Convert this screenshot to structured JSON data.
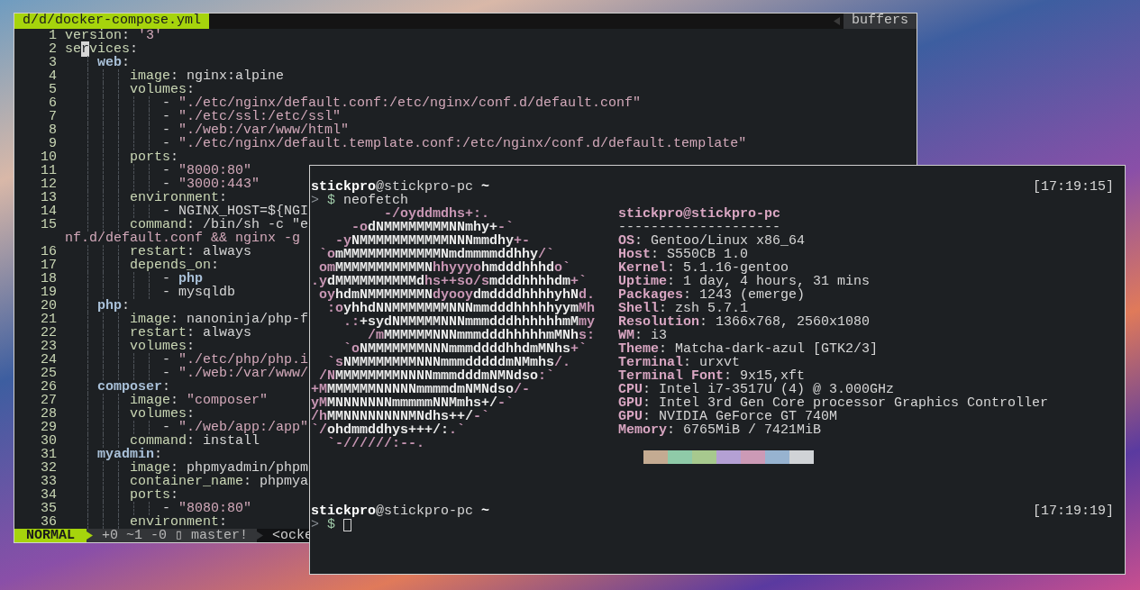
{
  "editor": {
    "tab": "d/d/docker-compose.yml",
    "buffers_label": "buffers",
    "lines": [
      {
        "number": "1",
        "segments": [
          {
            "kind": "key",
            "text": "version"
          },
          {
            "kind": "plain",
            "text": ": "
          },
          {
            "kind": "string",
            "text": "'3'"
          }
        ]
      },
      {
        "number": "2",
        "segments": [
          {
            "kind": "key",
            "text": "se"
          },
          {
            "kind": "cursor",
            "text": "r"
          },
          {
            "kind": "key",
            "text": "vices"
          },
          {
            "kind": "plain",
            "text": ":"
          }
        ]
      },
      {
        "number": "3",
        "segments": [
          {
            "kind": "section",
            "text": "    web"
          },
          {
            "kind": "plain",
            "text": ":"
          }
        ]
      },
      {
        "number": "4",
        "segments": [
          {
            "kind": "key",
            "text": "        image"
          },
          {
            "kind": "plain",
            "text": ": nginx:alpine"
          }
        ]
      },
      {
        "number": "5",
        "segments": [
          {
            "kind": "key",
            "text": "        volumes"
          },
          {
            "kind": "plain",
            "text": ":"
          }
        ]
      },
      {
        "number": "6",
        "segments": [
          {
            "kind": "plain",
            "text": "            - "
          },
          {
            "kind": "string",
            "text": "\"./etc/nginx/default.conf:/etc/nginx/conf.d/default.conf\""
          }
        ]
      },
      {
        "number": "7",
        "segments": [
          {
            "kind": "plain",
            "text": "            - "
          },
          {
            "kind": "string",
            "text": "\"./etc/ssl:/etc/ssl\""
          }
        ]
      },
      {
        "number": "8",
        "segments": [
          {
            "kind": "plain",
            "text": "            - "
          },
          {
            "kind": "string",
            "text": "\"./web:/var/www/html\""
          }
        ]
      },
      {
        "number": "9",
        "segments": [
          {
            "kind": "plain",
            "text": "            - "
          },
          {
            "kind": "string",
            "text": "\"./etc/nginx/default.template.conf:/etc/nginx/conf.d/default.template\""
          }
        ]
      },
      {
        "number": "10",
        "segments": [
          {
            "kind": "key",
            "text": "        ports"
          },
          {
            "kind": "plain",
            "text": ":"
          }
        ]
      },
      {
        "number": "11",
        "segments": [
          {
            "kind": "plain",
            "text": "            - "
          },
          {
            "kind": "string",
            "text": "\"8000:80\""
          }
        ]
      },
      {
        "number": "12",
        "segments": [
          {
            "kind": "plain",
            "text": "            - "
          },
          {
            "kind": "string",
            "text": "\"3000:443\""
          }
        ]
      },
      {
        "number": "13",
        "segments": [
          {
            "kind": "key",
            "text": "        environment"
          },
          {
            "kind": "plain",
            "text": ":"
          }
        ]
      },
      {
        "number": "14",
        "segments": [
          {
            "kind": "plain",
            "text": "            - NGINX_HOST=${NGI"
          }
        ]
      },
      {
        "number": "15",
        "segments": [
          {
            "kind": "key",
            "text": "        command"
          },
          {
            "kind": "plain",
            "text": ": /bin/sh -c \"e"
          }
        ],
        "wrap": "nf.d/default.conf && nginx -g"
      },
      {
        "number": "16",
        "segments": [
          {
            "kind": "key",
            "text": "        restart"
          },
          {
            "kind": "plain",
            "text": ": always"
          }
        ]
      },
      {
        "number": "17",
        "segments": [
          {
            "kind": "key",
            "text": "        depends_on"
          },
          {
            "kind": "plain",
            "text": ":"
          }
        ]
      },
      {
        "number": "18",
        "segments": [
          {
            "kind": "plain",
            "text": "            - "
          },
          {
            "kind": "section",
            "text": "php"
          }
        ]
      },
      {
        "number": "19",
        "segments": [
          {
            "kind": "plain",
            "text": "            - mysqldb"
          }
        ]
      },
      {
        "number": "20",
        "segments": [
          {
            "kind": "section",
            "text": "    php"
          },
          {
            "kind": "plain",
            "text": ":"
          }
        ]
      },
      {
        "number": "21",
        "segments": [
          {
            "kind": "key",
            "text": "        image"
          },
          {
            "kind": "plain",
            "text": ": nanoninja/php-f"
          }
        ]
      },
      {
        "number": "22",
        "segments": [
          {
            "kind": "key",
            "text": "        restart"
          },
          {
            "kind": "plain",
            "text": ": always"
          }
        ]
      },
      {
        "number": "23",
        "segments": [
          {
            "kind": "key",
            "text": "        volumes"
          },
          {
            "kind": "plain",
            "text": ":"
          }
        ]
      },
      {
        "number": "24",
        "segments": [
          {
            "kind": "plain",
            "text": "            - "
          },
          {
            "kind": "string",
            "text": "\"./etc/php/php.i"
          }
        ]
      },
      {
        "number": "25",
        "segments": [
          {
            "kind": "plain",
            "text": "            - "
          },
          {
            "kind": "string",
            "text": "\"./web:/var/www/"
          }
        ]
      },
      {
        "number": "26",
        "segments": [
          {
            "kind": "section",
            "text": "    composer"
          },
          {
            "kind": "plain",
            "text": ":"
          }
        ]
      },
      {
        "number": "27",
        "segments": [
          {
            "kind": "key",
            "text": "        image"
          },
          {
            "kind": "plain",
            "text": ": "
          },
          {
            "kind": "string",
            "text": "\"composer\""
          }
        ]
      },
      {
        "number": "28",
        "segments": [
          {
            "kind": "key",
            "text": "        volumes"
          },
          {
            "kind": "plain",
            "text": ":"
          }
        ]
      },
      {
        "number": "29",
        "segments": [
          {
            "kind": "plain",
            "text": "            - "
          },
          {
            "kind": "string",
            "text": "\"./web/app:/app\""
          }
        ]
      },
      {
        "number": "30",
        "segments": [
          {
            "kind": "key",
            "text": "        command"
          },
          {
            "kind": "plain",
            "text": ": install"
          }
        ]
      },
      {
        "number": "31",
        "segments": [
          {
            "kind": "section",
            "text": "    myadmin"
          },
          {
            "kind": "plain",
            "text": ":"
          }
        ]
      },
      {
        "number": "32",
        "segments": [
          {
            "kind": "key",
            "text": "        image"
          },
          {
            "kind": "plain",
            "text": ": phpmyadmin/phpm"
          }
        ]
      },
      {
        "number": "33",
        "segments": [
          {
            "kind": "key",
            "text": "        container_name"
          },
          {
            "kind": "plain",
            "text": ": phpmya"
          }
        ]
      },
      {
        "number": "34",
        "segments": [
          {
            "kind": "key",
            "text": "        ports"
          },
          {
            "kind": "plain",
            "text": ":"
          }
        ]
      },
      {
        "number": "35",
        "segments": [
          {
            "kind": "plain",
            "text": "            - "
          },
          {
            "kind": "string",
            "text": "\"8080:80\""
          }
        ]
      },
      {
        "number": "36",
        "segments": [
          {
            "kind": "key",
            "text": "        environment"
          },
          {
            "kind": "plain",
            "text": ":"
          }
        ]
      }
    ],
    "status": {
      "mode": "NORMAL",
      "git": "+0 ~1 -0 ▯ master!",
      "file": "<ocke"
    }
  },
  "terminal": {
    "sessions": [
      {
        "user": "stickpro",
        "host": "@stickpro-pc",
        "dir": "~",
        "time": "[17:19:15]",
        "marker": ">",
        "symbol": "$",
        "command": "neofetch",
        "cursor": false
      },
      {
        "user": "stickpro",
        "host": "@stickpro-pc",
        "dir": "~",
        "time": "[17:19:19]",
        "marker": ">",
        "symbol": "$",
        "cursor": true
      }
    ],
    "neofetch": {
      "art": [
        [
          {
            "kind": "accent",
            "text": "         -/oyddmdhs+:."
          }
        ],
        [
          {
            "kind": "accent",
            "text": "     -o"
          },
          {
            "kind": "light",
            "text": "dNMMMMMMMMNNmhy+"
          },
          {
            "kind": "accent",
            "text": "-`"
          }
        ],
        [
          {
            "kind": "accent",
            "text": "   -y"
          },
          {
            "kind": "light",
            "text": "NMMMMMMMMMMMNNNmmdhy"
          },
          {
            "kind": "accent",
            "text": "+-"
          }
        ],
        [
          {
            "kind": "accent",
            "text": " `o"
          },
          {
            "kind": "light",
            "text": "mMMMMMMMMMMMMNmdmmmmddhhy"
          },
          {
            "kind": "accent",
            "text": "/`"
          }
        ],
        [
          {
            "kind": "accent",
            "text": " om"
          },
          {
            "kind": "light",
            "text": "MMMMMMMMMMMN"
          },
          {
            "kind": "accent",
            "text": "hhyyyo"
          },
          {
            "kind": "light",
            "text": "hmdddhhhd"
          },
          {
            "kind": "accent",
            "text": "o`"
          }
        ],
        [
          {
            "kind": "accent",
            "text": ".y"
          },
          {
            "kind": "light",
            "text": "dMMMMMMMMMMd"
          },
          {
            "kind": "accent",
            "text": "hs++so/s"
          },
          {
            "kind": "light",
            "text": "mdddhhhhdm"
          },
          {
            "kind": "accent",
            "text": "+`"
          }
        ],
        [
          {
            "kind": "accent",
            "text": " oy"
          },
          {
            "kind": "light",
            "text": "hdmNMMMMMMMN"
          },
          {
            "kind": "accent",
            "text": "dyooy"
          },
          {
            "kind": "light",
            "text": "dmddddhhhhyhN"
          },
          {
            "kind": "accent",
            "text": "d."
          }
        ],
        [
          {
            "kind": "accent",
            "text": "  :o"
          },
          {
            "kind": "light",
            "text": "yhhdNNMMMMMMMNNNmmdddhhhhhyym"
          },
          {
            "kind": "accent",
            "text": "Mh"
          }
        ],
        [
          {
            "kind": "accent",
            "text": "    .:"
          },
          {
            "kind": "light",
            "text": "+sydNMMMMMNNNmmmdddhhhhhhmM"
          },
          {
            "kind": "accent",
            "text": "my"
          }
        ],
        [
          {
            "kind": "accent",
            "text": "       /m"
          },
          {
            "kind": "light",
            "text": "MMMMMMNNNmmmdddhhhhhmMNh"
          },
          {
            "kind": "accent",
            "text": "s:"
          }
        ],
        [
          {
            "kind": "accent",
            "text": "    `o"
          },
          {
            "kind": "light",
            "text": "NMMMMMMMNNNmmmddddhhdmMNhs"
          },
          {
            "kind": "accent",
            "text": "+`"
          }
        ],
        [
          {
            "kind": "accent",
            "text": "  `s"
          },
          {
            "kind": "light",
            "text": "NMMMMMMMMNNNmmmdddddmNMmhs"
          },
          {
            "kind": "accent",
            "text": "/."
          }
        ],
        [
          {
            "kind": "accent",
            "text": " /N"
          },
          {
            "kind": "light",
            "text": "MMMMMMMMNNNNmmmdddmNMNdso"
          },
          {
            "kind": "accent",
            "text": ":`"
          }
        ],
        [
          {
            "kind": "accent",
            "text": "+M"
          },
          {
            "kind": "light",
            "text": "MMMMMMNNNNNmmmmdmNMNdso"
          },
          {
            "kind": "accent",
            "text": "/-"
          }
        ],
        [
          {
            "kind": "accent",
            "text": "yM"
          },
          {
            "kind": "light",
            "text": "MNNNNNNNmmmmmNNMmhs+/"
          },
          {
            "kind": "accent",
            "text": "-`"
          }
        ],
        [
          {
            "kind": "accent",
            "text": "/h"
          },
          {
            "kind": "light",
            "text": "MMNNNNNNNNMNdhs++/"
          },
          {
            "kind": "accent",
            "text": "-`"
          }
        ],
        [
          {
            "kind": "accent",
            "text": "`/"
          },
          {
            "kind": "light",
            "text": "ohdmmddhys+++/:"
          },
          {
            "kind": "accent",
            "text": ".`"
          }
        ],
        [
          {
            "kind": "accent",
            "text": "  `-//////:--."
          }
        ]
      ],
      "title": "stickpro@stickpro-pc",
      "rule": "--------------------",
      "info": [
        {
          "label": "OS",
          "value": ": Gentoo/Linux x86_64"
        },
        {
          "label": "Host",
          "value": ": S550CB 1.0"
        },
        {
          "label": "Kernel",
          "value": ": 5.1.16-gentoo"
        },
        {
          "label": "Uptime",
          "value": ": 1 day, 4 hours, 31 mins"
        },
        {
          "label": "Packages",
          "value": ": 1243 (emerge)"
        },
        {
          "label": "Shell",
          "value": ": zsh 5.7.1"
        },
        {
          "label": "Resolution",
          "value": ": 1366x768, 2560x1080"
        },
        {
          "label": "WM",
          "value": ": i3"
        },
        {
          "label": "Theme",
          "value": ": Matcha-dark-azul [GTK2/3]"
        },
        {
          "label": "Terminal",
          "value": ": urxvt"
        },
        {
          "label": "Terminal Font",
          "value": ": 9x15,xft"
        },
        {
          "label": "CPU",
          "value": ": Intel i7-3517U (4) @ 3.000GHz"
        },
        {
          "label": "GPU",
          "value": ": Intel 3rd Gen Core processor Graphics Controller"
        },
        {
          "label": "GPU",
          "value": ": NVIDIA GeForce GT 740M"
        },
        {
          "label": "Memory",
          "value": ": 6765MiB / 7421MiB"
        }
      ],
      "palette": [
        {
          "color": "#c4ab92"
        },
        {
          "color": "#8fcaa8"
        },
        {
          "color": "#a7c98e"
        },
        {
          "color": "#b4a0d4"
        },
        {
          "color": "#cc9ab6"
        },
        {
          "color": "#97b3d0"
        },
        {
          "color": "#d0d3d6"
        }
      ]
    }
  }
}
